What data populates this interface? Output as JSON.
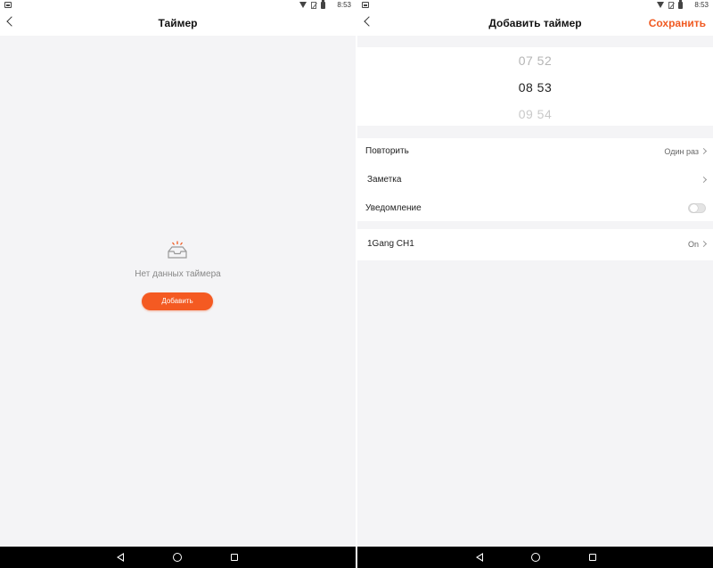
{
  "status": {
    "time": "8:53"
  },
  "timer_list": {
    "title": "Таймер",
    "empty_text": "Нет данных таймера",
    "add_button": "Добавить"
  },
  "add_timer": {
    "title": "Добавить таймер",
    "save_label": "Сохранить",
    "picker": {
      "prev": "07 52",
      "current": "08 53",
      "next": "09 54"
    },
    "repeat": {
      "label": "Повторить",
      "value": "Один раз"
    },
    "note": {
      "label": "Заметка"
    },
    "notification": {
      "label": "Уведомление",
      "enabled": false
    },
    "device": {
      "label": "1Gang CH1",
      "value": "On"
    }
  },
  "colors": {
    "accent": "#f05a22",
    "background": "#f4f4f6"
  },
  "icons": [
    "back-icon",
    "empty-inbox-icon",
    "chevron-right-icon",
    "wifi-icon",
    "battery-icon",
    "nav-back-icon",
    "nav-home-icon",
    "nav-recent-icon"
  ]
}
